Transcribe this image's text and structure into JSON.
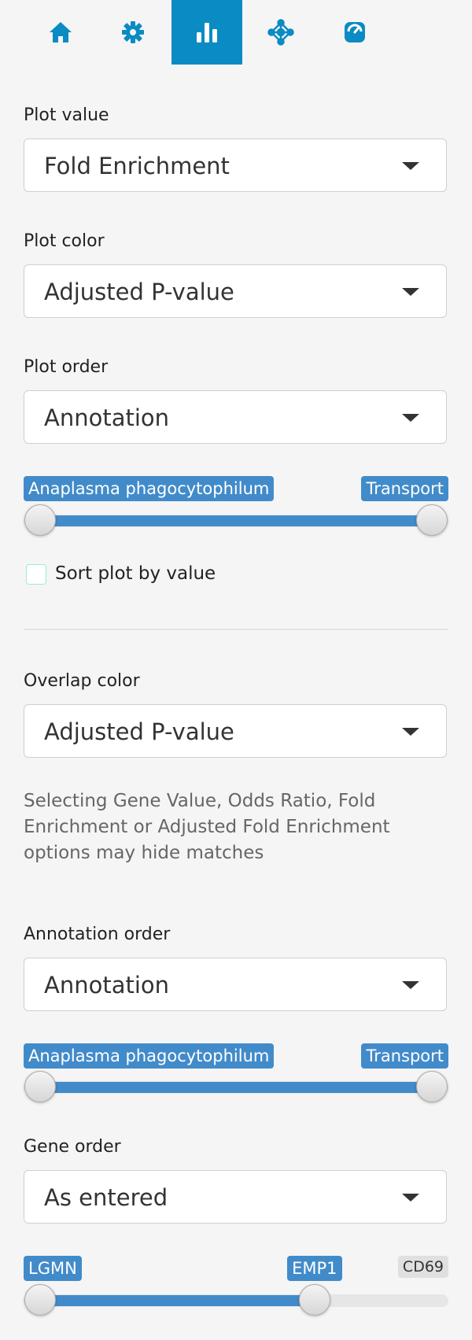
{
  "tabs": [
    {
      "name": "home",
      "icon": "home-icon"
    },
    {
      "name": "settings",
      "icon": "gear-icon"
    },
    {
      "name": "plot",
      "icon": "bar-chart-icon",
      "active": true
    },
    {
      "name": "network",
      "icon": "network-icon"
    },
    {
      "name": "gauge",
      "icon": "gauge-icon"
    }
  ],
  "plot_value": {
    "label": "Plot value",
    "selected": "Fold Enrichment"
  },
  "plot_color": {
    "label": "Plot color",
    "selected": "Adjusted P-value"
  },
  "plot_order": {
    "label": "Plot order",
    "selected": "Annotation"
  },
  "plot_range": {
    "min_label": "Anaplasma phagocytophilum",
    "max_label": "Transport",
    "from_fraction": 0.0,
    "to_fraction": 1.0
  },
  "sort_checkbox": {
    "label": "Sort plot by value",
    "checked": false
  },
  "overlap_color": {
    "label": "Overlap color",
    "selected": "Adjusted P-value"
  },
  "help_text": "Selecting Gene Value, Odds Ratio, Fold Enrichment or Adjusted Fold Enrichment options may hide matches",
  "annotation_order": {
    "label": "Annotation order",
    "selected": "Annotation"
  },
  "annotation_range": {
    "min_label": "Anaplasma phagocytophilum",
    "max_label": "Transport",
    "from_fraction": 0.0,
    "to_fraction": 1.0
  },
  "gene_order": {
    "label": "Gene order",
    "selected": "As entered"
  },
  "gene_range": {
    "from_label": "LGMN",
    "to_label": "EMP1",
    "max_label": "CD69",
    "from_fraction": 0.0,
    "to_fraction": 0.7
  },
  "colors": {
    "accent": "#0b8bc3",
    "slider": "#428bca"
  }
}
